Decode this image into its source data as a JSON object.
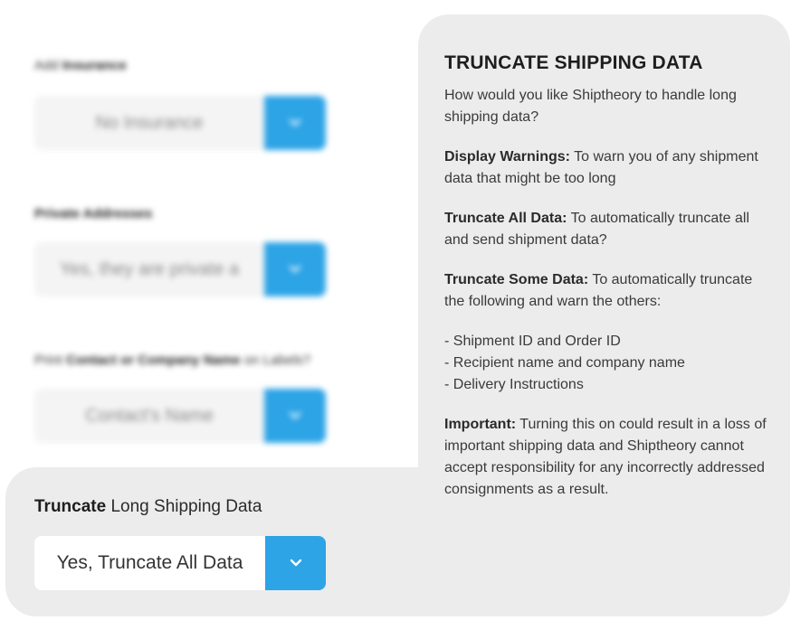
{
  "fields": [
    {
      "label_prefix": "Add",
      "label_bold": "Insurance",
      "label_suffix": "",
      "value": "No Insurance"
    },
    {
      "label_prefix": "",
      "label_bold": "Private Addresses",
      "label_suffix": "",
      "value": "Yes, they are private a"
    },
    {
      "label_prefix": "Print",
      "label_bold": "Contact or Company Name",
      "label_suffix": "on Labels?",
      "value": "Contact's Name"
    }
  ],
  "active_field": {
    "label_bold": "Truncate",
    "label_rest": "Long Shipping Data",
    "value": "Yes, Truncate All Data"
  },
  "tooltip": {
    "title": "TRUNCATE SHIPPING DATA",
    "intro": "How would you like Shiptheory to handle long shipping data?",
    "option1_bold": "Display Warnings:",
    "option1_text": "To warn you of any shipment data that might be too long",
    "option2_bold": "Truncate All Data:",
    "option2_text": "To automatically truncate all and send shipment data?",
    "option3_bold": "Truncate Some Data:",
    "option3_text": "To automatically truncate the following and warn the others:",
    "list": [
      "Shipment ID and Order ID",
      "Recipient name and company name",
      "Delivery Instructions"
    ],
    "note_bold": "Important:",
    "note_text": "Turning this on could result in a loss of important shipping data and Shiptheory cannot accept responsibility for any incorrectly addressed consignments as a result."
  },
  "colors": {
    "accent": "#2da4e6",
    "panel": "#ececec"
  },
  "icons": {
    "dropdown": "chevron-down-icon"
  }
}
